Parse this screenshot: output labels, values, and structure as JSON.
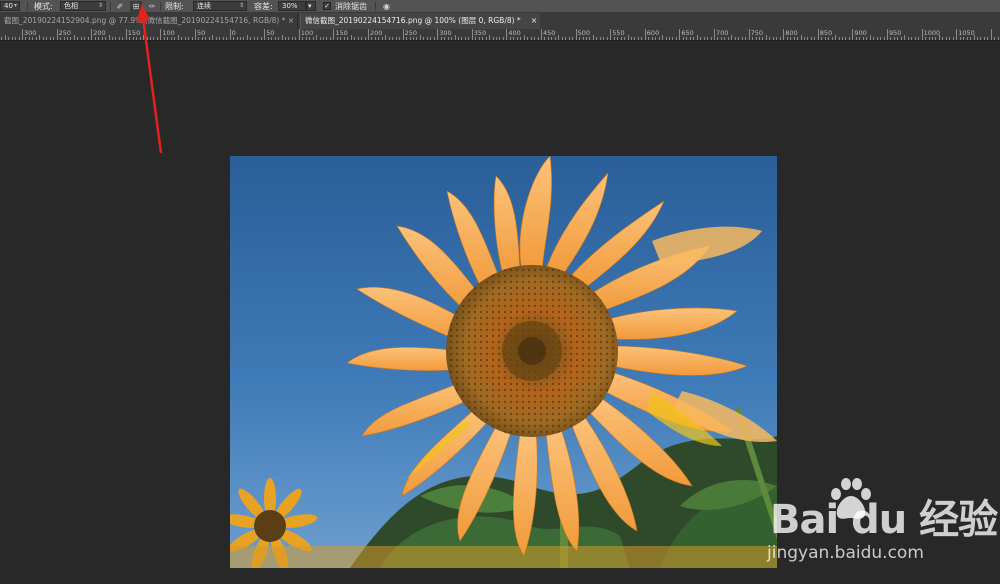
{
  "options_bar": {
    "size_value": "40",
    "mode_label": "模式:",
    "mode_value": "色相",
    "limit_label": "限制:",
    "limit_value": "连续",
    "tolerance_label": "容差:",
    "tolerance_value": "30%",
    "antialias_checked": true,
    "antialias_label": "消除锯齿"
  },
  "tabs": [
    {
      "label": "截图_20190224152904.png @ 77.9% (微信截图_20190224154716, RGB/8) *",
      "close": "×",
      "active": false
    },
    {
      "label": "微信截图_20190224154716.png @ 100% (图层 0, RGB/8) *",
      "close": "×",
      "active": true
    }
  ],
  "ruler": {
    "labels": [
      "300",
      "250",
      "200",
      "150",
      "100",
      "50",
      "0",
      "50",
      "100",
      "150",
      "200",
      "250",
      "300",
      "350",
      "400",
      "450",
      "500",
      "550",
      "600",
      "650",
      "700",
      "750",
      "800",
      "850",
      "900",
      "950",
      "1000",
      "1050"
    ]
  },
  "watermark": {
    "logo": "Bai du 经验",
    "url": "jingyan.baidu.com"
  },
  "colors": {
    "app_bg": "#282828",
    "panel": "#535353",
    "sky": "#2f6aa8",
    "petal": "#f6a94a",
    "arrow": "#e0231d"
  }
}
